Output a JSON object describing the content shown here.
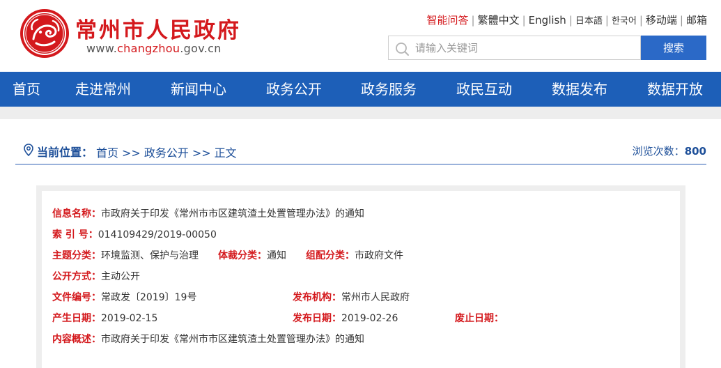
{
  "header": {
    "site_name": "常州市人民政府",
    "url_prefix": "www.",
    "url_mid": "changzhou",
    "url_suffix": ".gov.cn",
    "lang_links": [
      "智能问答",
      "繁體中文",
      "English",
      "日本語",
      "한국어",
      "移动端",
      "邮箱"
    ],
    "search_placeholder": "请输入关键词",
    "search_button": "搜索"
  },
  "nav": {
    "items": [
      "首页",
      "走进常州",
      "新闻中心",
      "政务公开",
      "政务服务",
      "政民互动",
      "数据发布",
      "数据开放"
    ]
  },
  "breadcrumb": {
    "label": "当前位置：",
    "items": [
      "首页",
      "政务公开",
      "正文"
    ],
    "separator": ">>",
    "views_label": "浏览次数：",
    "views_count": "800"
  },
  "info": {
    "title_label": "信息名称：",
    "title_value": "市政府关于印发《常州市市区建筑渣土处置管理办法》的通知",
    "index_label": "索 引 号：",
    "index_value": "014109429/2019-00050",
    "topic_label": "主题分类：",
    "topic_value": "环境监测、保护与治理",
    "genre_label": "体裁分类：",
    "genre_value": "通知",
    "group_label": "组配分类：",
    "group_value": "市政府文件",
    "open_label": "公开方式：",
    "open_value": "主动公开",
    "doc_no_label": "文件编号：",
    "doc_no_value": "常政发〔2019〕19号",
    "issuer_label": "发布机构：",
    "issuer_value": "常州市人民政府",
    "created_label": "产生日期：",
    "created_value": "2019-02-15",
    "published_label": "发布日期：",
    "published_value": "2019-02-26",
    "expired_label": "废止日期：",
    "expired_value": "",
    "summary_label": "内容概述：",
    "summary_value": "市政府关于印发《常州市市区建筑渣土处置管理办法》的通知"
  },
  "colors": {
    "brand_red": "#d4191d",
    "nav_blue": "#1d5fb8",
    "button_blue": "#2b69c7",
    "crumb_blue": "#1d4f99"
  }
}
